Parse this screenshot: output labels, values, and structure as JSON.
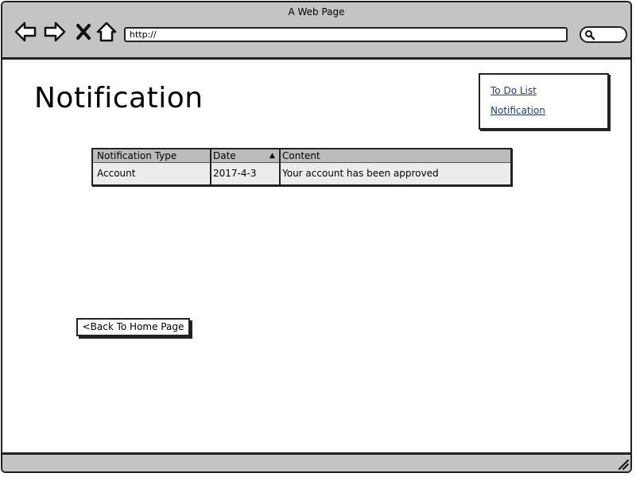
{
  "window": {
    "title": "A Web Page"
  },
  "browser": {
    "url": "http://",
    "icons": [
      "back-arrow-icon",
      "forward-arrow-icon",
      "close-x-icon",
      "home-icon",
      "search-icon"
    ]
  },
  "page": {
    "title": "Notification"
  },
  "nav": {
    "links": [
      {
        "label": "To Do List"
      },
      {
        "label": "Notification"
      }
    ]
  },
  "table": {
    "headers": [
      "Notification Type",
      "Date",
      "Content"
    ],
    "sorted_column": "Date",
    "rows": [
      [
        "Account",
        "2017-4-3",
        "Your account has been approved"
      ]
    ]
  },
  "actions": {
    "back_label": "<Back To Home Page"
  },
  "colors": {
    "chrome": "#c4c4c4",
    "link": "#1a3a8a",
    "table_header": "#bcbcbc",
    "table_body": "#ececec"
  }
}
